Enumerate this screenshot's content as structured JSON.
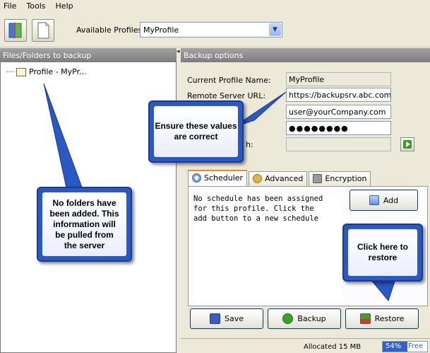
{
  "menu": [
    "File",
    "Tools",
    "Help"
  ],
  "toolbar": {
    "profiles_label": "Available Profiles:",
    "profile_value": "MyProfile"
  },
  "left": {
    "header": "Files/Folders to backup",
    "tree_item": "Profile - MyPr..."
  },
  "right": {
    "header": "Backup options",
    "fields": {
      "profile_name_label": "Current Profile Name:",
      "profile_name_value": "MyProfile",
      "server_url_label": "Remote Server URL:",
      "server_url_value": "https://backupsrv.abc.com",
      "user_value": "user@yourCompany.com",
      "password_value": "●●●●●●●●",
      "path_label_fragment": "h:"
    },
    "tabs": [
      "Scheduler",
      "Advanced",
      "Encryption"
    ],
    "scheduler_text": "No schedule has been assigned\nfor this profile. Click the\nadd button to a new schedule",
    "add_label": "Add",
    "buttons": {
      "save": "Save",
      "backup": "Backup",
      "restore": "Restore"
    }
  },
  "status": {
    "allocated": "Allocated 15 MB",
    "mem_pct": "54%",
    "mem_free": "Free"
  },
  "callouts": {
    "values": "Ensure these values are correct",
    "folders": "No folders have been added. This information will be pulled from the server",
    "restore": "Click here to restore"
  },
  "colors": {
    "callout_border": "#2a58c4",
    "tab_accent": "#e68b2c",
    "header_bg": "#8d8d8d"
  }
}
